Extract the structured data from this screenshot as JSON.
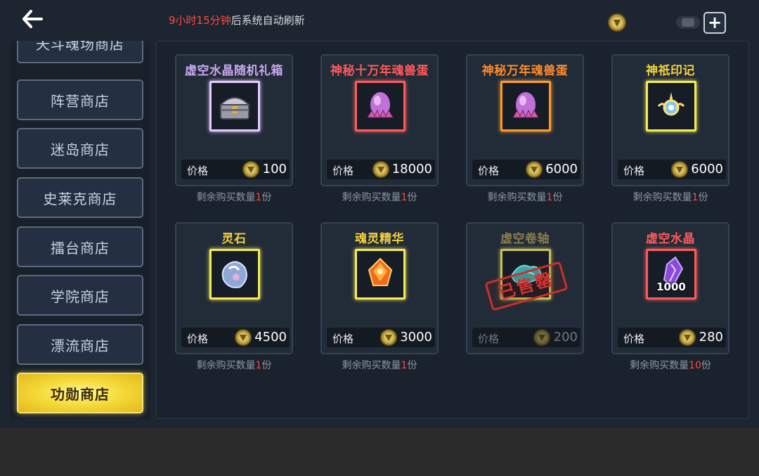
{
  "header": {
    "refresh_prefix": "9小时15分钟",
    "refresh_suffix": "后系统自动刷新",
    "plus_label": "+"
  },
  "sidebar": {
    "items": [
      {
        "label": "天斗魂场商店"
      },
      {
        "label": "阵营商店"
      },
      {
        "label": "迷岛商店"
      },
      {
        "label": "史莱克商店"
      },
      {
        "label": "擂台商店"
      },
      {
        "label": "学院商店"
      },
      {
        "label": "漂流商店"
      },
      {
        "label": "功勋商店",
        "active": true
      }
    ]
  },
  "shop": {
    "price_label": "价格",
    "remain_prefix": "剩余购买数量",
    "remain_suffix": "份",
    "items": [
      {
        "name": "虚空水晶随机礼箱",
        "name_color": "#c9a8ee",
        "frame_color": "#e6c8ff",
        "icon": "treasure-chest-icon",
        "price": "100",
        "remain": "1"
      },
      {
        "name": "神秘十万年魂兽蛋",
        "name_color": "#ff5a5a",
        "frame_color": "#ff5a5a",
        "icon": "beast-egg-icon",
        "price": "18000",
        "remain": "1"
      },
      {
        "name": "神秘万年魂兽蛋",
        "name_color": "#ff8a2a",
        "frame_color": "#ff9a2a",
        "icon": "beast-egg-icon",
        "price": "6000",
        "remain": "1"
      },
      {
        "name": "神祇印记",
        "name_color": "#f3d23c",
        "frame_color": "#f5ea55",
        "icon": "divine-mark-icon",
        "price": "6000",
        "remain": "1"
      },
      {
        "name": "灵石",
        "name_color": "#f3d23c",
        "frame_color": "#f5ea55",
        "icon": "spirit-stone-icon",
        "price": "4500",
        "remain": "1"
      },
      {
        "name": "魂灵精华",
        "name_color": "#f3d23c",
        "frame_color": "#f5ea55",
        "icon": "soul-essence-icon",
        "price": "3000",
        "remain": "1"
      },
      {
        "name": "虚空卷轴",
        "name_color": "#8a7c4e",
        "frame_color": "#c9c055",
        "icon": "void-scroll-icon",
        "price": "200",
        "sold_out": true,
        "stamp": "已售罄"
      },
      {
        "name": "虚空水晶",
        "name_color": "#ff5a5a",
        "frame_color": "#ff5a5a",
        "icon": "void-crystal-icon",
        "price": "280",
        "remain": "10",
        "qty": "1000"
      }
    ]
  }
}
